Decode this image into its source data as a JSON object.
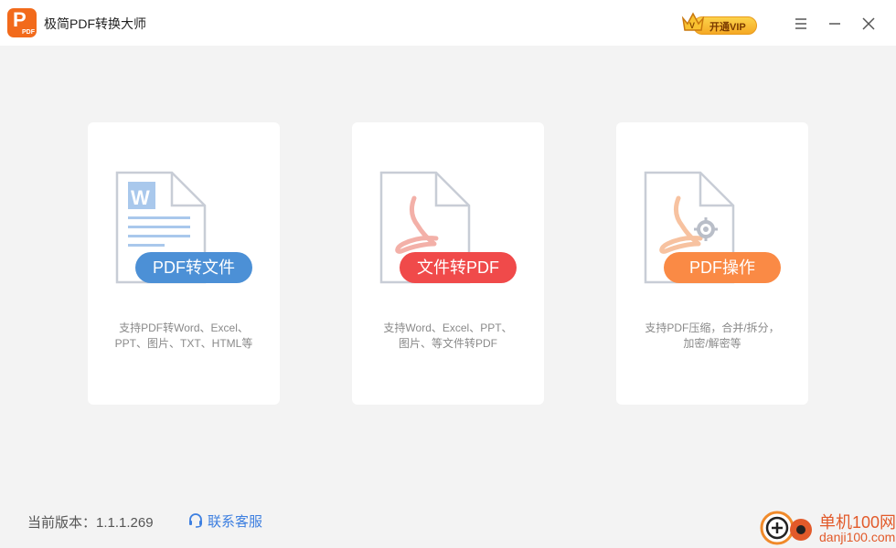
{
  "app": {
    "title": "极简PDF转换大师",
    "logo_letter": "P",
    "logo_sub": "PDF"
  },
  "titlebar": {
    "vip_label": "开通VIP",
    "icons": [
      "menu-icon",
      "minimize-icon",
      "close-icon"
    ]
  },
  "cards": [
    {
      "label": "PDF转文件",
      "desc_line1": "支持PDF转Word、Excel、",
      "desc_line2": "PPT、图片、TXT、HTML等",
      "color": "#4c90d6",
      "icon": "word-document-icon"
    },
    {
      "label": "文件转PDF",
      "desc_line1": "支持Word、Excel、PPT、",
      "desc_line2": "图片、等文件转PDF",
      "color": "#f04a4a",
      "icon": "pdf-document-icon"
    },
    {
      "label": "PDF操作",
      "desc_line1": "支持PDF压缩，合并/拆分，",
      "desc_line2": "加密/解密等",
      "color": "#fa8a45",
      "icon": "pdf-gear-document-icon"
    }
  ],
  "footer": {
    "version": "当前版本：1.1.1.269",
    "contact_label": "联系客服"
  },
  "watermark": {
    "line1": "单机100网",
    "line2": "danji100.com"
  }
}
